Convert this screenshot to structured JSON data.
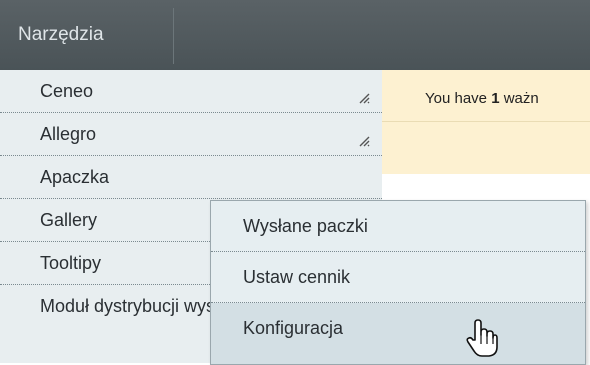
{
  "header": {
    "tab_label": "Narzędzia"
  },
  "notice": {
    "prefix": "You have ",
    "count": "1",
    "suffix": " ważn"
  },
  "menu": {
    "items": [
      {
        "label": "Ceneo",
        "has_resize": true
      },
      {
        "label": "Allegro",
        "has_resize": true
      },
      {
        "label": "Apaczka",
        "has_resize": false
      },
      {
        "label": "Gallery",
        "has_resize": false
      },
      {
        "label": "Tooltipy",
        "has_resize": false
      },
      {
        "label": "Moduł dystrybucji wysyłek",
        "has_resize": false
      }
    ]
  },
  "submenu": {
    "items": [
      {
        "label": "Wysłane paczki"
      },
      {
        "label": "Ustaw cennik"
      },
      {
        "label": "Konfiguracja"
      }
    ]
  },
  "colors": {
    "topbar": "#4f585c",
    "menu_bg": "#e8eef0",
    "notice_bg": "#fdf1d1",
    "submenu_hover": "#d3dfe4"
  },
  "icons": {
    "resize": "resize-grip-icon",
    "cursor": "hand-pointer-icon"
  }
}
